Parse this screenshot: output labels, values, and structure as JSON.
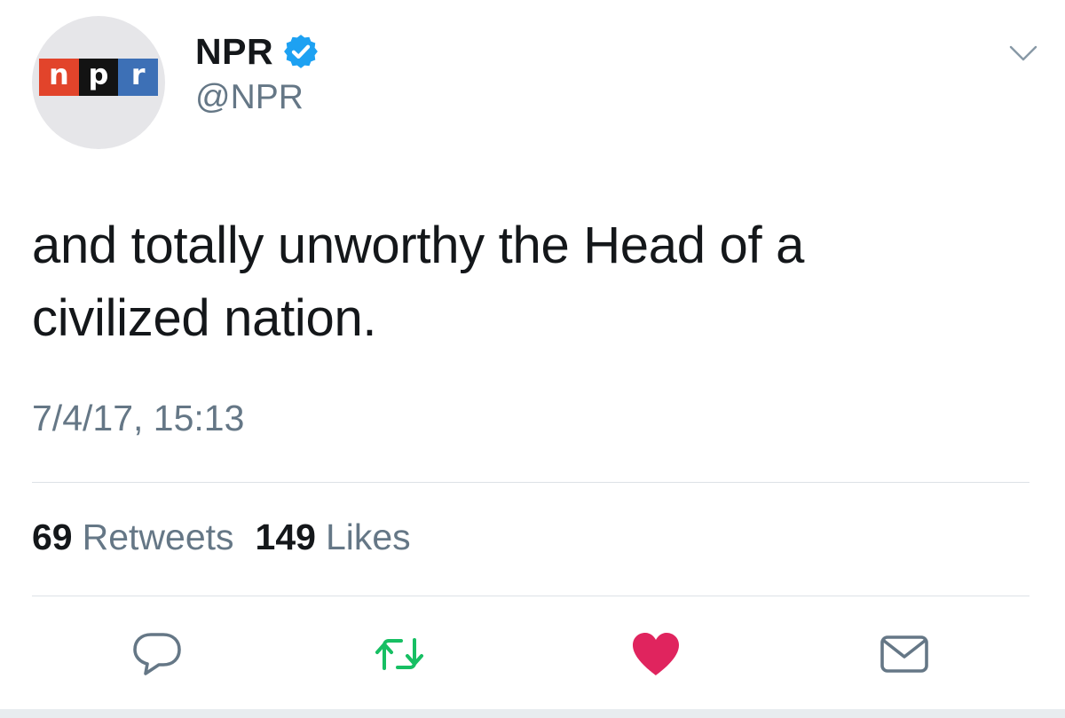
{
  "author": {
    "display_name": "NPR",
    "handle": "@NPR",
    "verified": true,
    "avatar_logo_letters": [
      "n",
      "p",
      "r"
    ]
  },
  "tweet": {
    "text_line1": "and totally unworthy the Head of a",
    "text_line2": "civilized nation.",
    "timestamp": "7/4/17, 15:13"
  },
  "stats": {
    "retweets_count": "69",
    "retweets_label": "Retweets",
    "likes_count": "149",
    "likes_label": "Likes"
  },
  "actions": {
    "reply_icon": "reply-icon",
    "retweet_icon": "retweet-icon",
    "like_icon": "heart-icon",
    "message_icon": "envelope-icon",
    "more_icon": "chevron-down-icon"
  },
  "colors": {
    "retweet_active": "#17bf63",
    "like_active": "#e0245e",
    "verified_badge": "#1da1f2",
    "npr_red": "#e2442b",
    "npr_black": "#131313",
    "npr_blue": "#3d70b6",
    "secondary_text": "#657786",
    "primary_text": "#14171a"
  }
}
